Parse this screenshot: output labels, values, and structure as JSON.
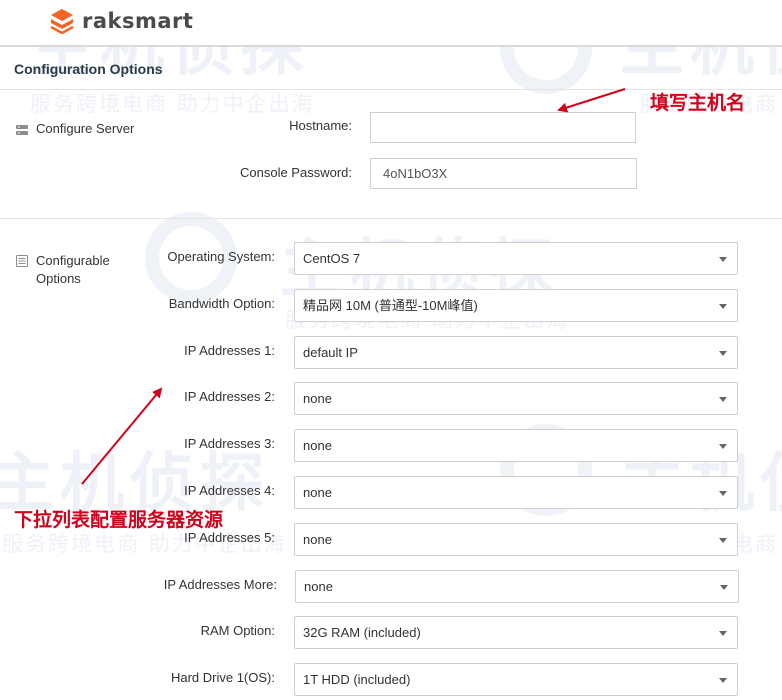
{
  "header": {
    "brand": "raksmart"
  },
  "page": {
    "section_title": "Configuration Options"
  },
  "watermark": {
    "logo_text": "主机侦探",
    "slogan": "服务跨境电商 助力中企出海"
  },
  "server": {
    "heading": "Configure Server",
    "hostname_label": "Hostname:",
    "hostname_value": "",
    "password_label": "Console Password:",
    "password_value": "4oN1bO3X"
  },
  "options": {
    "heading_line1": "Configurable",
    "heading_line2": "Options",
    "fields": [
      {
        "label": "Operating System:",
        "value": "CentOS 7"
      },
      {
        "label": "Bandwidth Option:",
        "value": "精品网 10M (普通型-10M峰值)"
      },
      {
        "label": "IP Addresses 1:",
        "value": "default IP"
      },
      {
        "label": "IP Addresses 2:",
        "value": "none"
      },
      {
        "label": "IP Addresses 3:",
        "value": "none"
      },
      {
        "label": "IP Addresses 4:",
        "value": "none"
      },
      {
        "label": "IP Addresses 5:",
        "value": "none"
      },
      {
        "label": "IP Addresses More:",
        "value": "none"
      },
      {
        "label": "RAM Option:",
        "value": "32G RAM (included)"
      },
      {
        "label": "Hard Drive 1(OS):",
        "value": "1T HDD (included)"
      }
    ]
  },
  "annotations": {
    "hostname_note": "填写主机名",
    "dropdown_note": "下拉列表配置服务器资源"
  },
  "colors": {
    "brand_orange": "#f26522",
    "annotation_red": "#d0021b",
    "title_navy": "#2a3a4a"
  }
}
